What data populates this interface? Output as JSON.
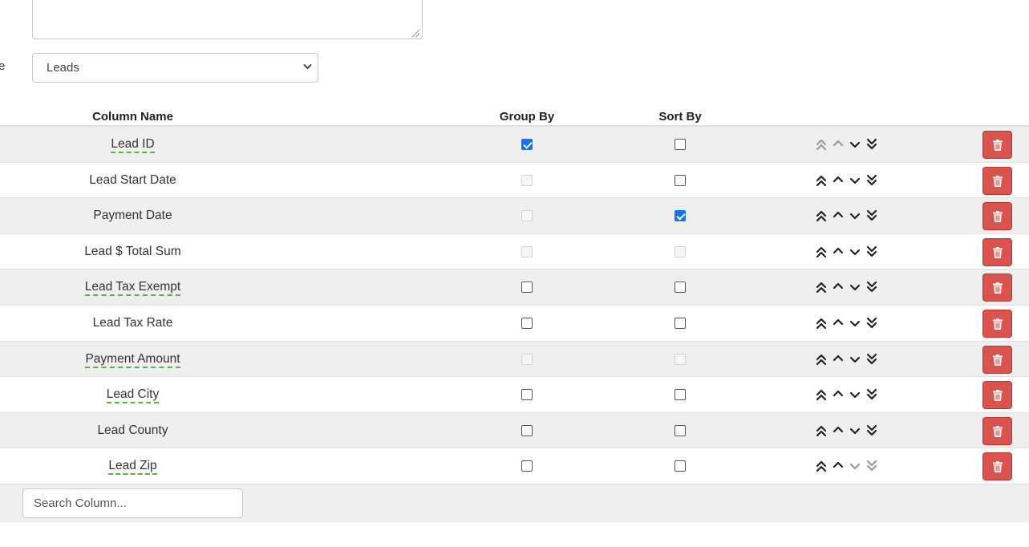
{
  "form": {
    "textarea_value": "",
    "cut_label": "e",
    "table_select": {
      "selected": "Leads"
    }
  },
  "table": {
    "headers": {
      "column_name": "Column Name",
      "group_by": "Group By",
      "sort_by": "Sort By"
    },
    "rows": [
      {
        "name": "Lead ID",
        "dashed": true,
        "group": "checked",
        "sort": "unchecked",
        "top_dim": true,
        "up_dim": true,
        "down_dim": false,
        "bottom_dim": false
      },
      {
        "name": "Lead Start Date",
        "dashed": false,
        "group": "disabled",
        "sort": "unchecked",
        "top_dim": false,
        "up_dim": false,
        "down_dim": false,
        "bottom_dim": false
      },
      {
        "name": "Payment Date",
        "dashed": false,
        "group": "disabled",
        "sort": "checked",
        "top_dim": false,
        "up_dim": false,
        "down_dim": false,
        "bottom_dim": false
      },
      {
        "name": "Lead $ Total Sum",
        "dashed": false,
        "group": "disabled",
        "sort": "disabled",
        "top_dim": false,
        "up_dim": false,
        "down_dim": false,
        "bottom_dim": false
      },
      {
        "name": "Lead Tax Exempt",
        "dashed": true,
        "group": "unchecked",
        "sort": "unchecked",
        "top_dim": false,
        "up_dim": false,
        "down_dim": false,
        "bottom_dim": false
      },
      {
        "name": "Lead Tax Rate",
        "dashed": false,
        "group": "unchecked",
        "sort": "unchecked",
        "top_dim": false,
        "up_dim": false,
        "down_dim": false,
        "bottom_dim": false
      },
      {
        "name": "Payment Amount",
        "dashed": true,
        "group": "disabled",
        "sort": "disabled",
        "top_dim": false,
        "up_dim": false,
        "down_dim": false,
        "bottom_dim": false
      },
      {
        "name": "Lead City",
        "dashed": true,
        "group": "unchecked",
        "sort": "unchecked",
        "top_dim": false,
        "up_dim": false,
        "down_dim": false,
        "bottom_dim": false
      },
      {
        "name": "Lead County",
        "dashed": false,
        "group": "unchecked",
        "sort": "unchecked",
        "top_dim": false,
        "up_dim": false,
        "down_dim": false,
        "bottom_dim": false
      },
      {
        "name": "Lead Zip",
        "dashed": true,
        "group": "unchecked",
        "sort": "unchecked",
        "top_dim": false,
        "up_dim": false,
        "down_dim": true,
        "bottom_dim": true
      }
    ],
    "icons": {
      "move_top": "double-chevron-up-icon",
      "move_up": "chevron-up-icon",
      "move_down": "chevron-down-icon",
      "move_bottom": "double-chevron-down-icon",
      "delete": "trash-icon"
    },
    "colors": {
      "delete_button": "#d9534f",
      "dashed_underline": "#58b33a",
      "checked": "#1a73e8",
      "row_stripe": "#efefef"
    }
  },
  "search": {
    "placeholder": "Search Column..."
  }
}
